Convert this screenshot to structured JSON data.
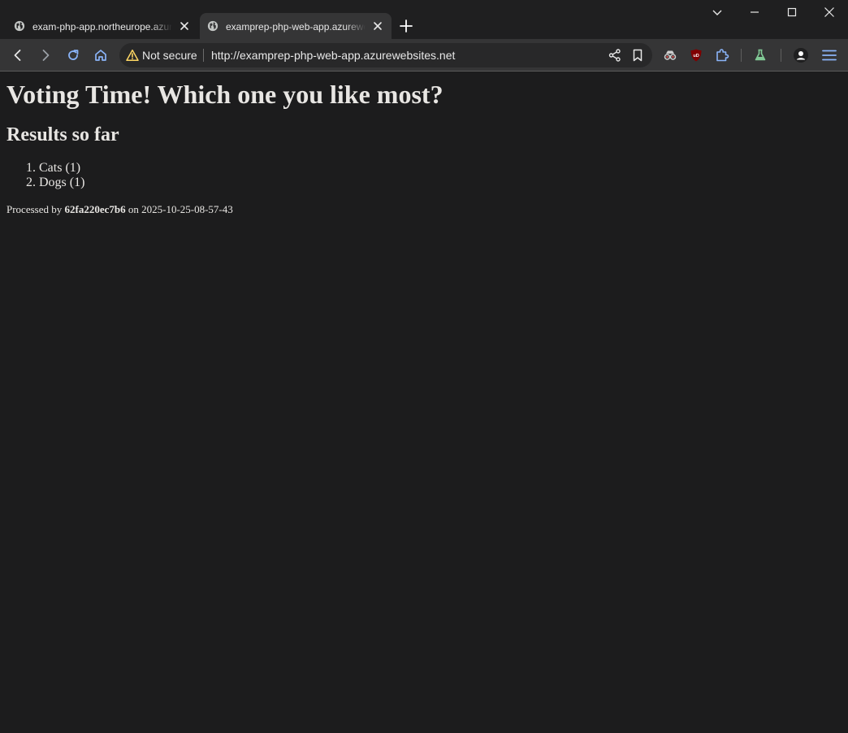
{
  "browser": {
    "tabs": [
      {
        "title": "exam-php-app.northeurope.azurewebsites.net",
        "active": false,
        "icon": "globe-icon"
      },
      {
        "title": "examprep-php-web-app.azurewebsites.net",
        "active": true,
        "icon": "globe-icon"
      }
    ],
    "security_label": "Not secure",
    "url": "http://examprep-php-web-app.azurewebsites.net",
    "colors": {
      "accent": "#8ab4f8",
      "warning": "#fdd663",
      "ublock": "#800000",
      "labs": "#81c995"
    }
  },
  "page": {
    "heading": "Voting Time! Which one you like most?",
    "subheading": "Results so far",
    "results": [
      {
        "label": "Cats (1)"
      },
      {
        "label": "Dogs (1)"
      }
    ],
    "footer": {
      "prefix": "Processed by",
      "host": "62fa220ec7b6",
      "middle": "on",
      "timestamp": "2025-10-25-08-57-43"
    }
  }
}
